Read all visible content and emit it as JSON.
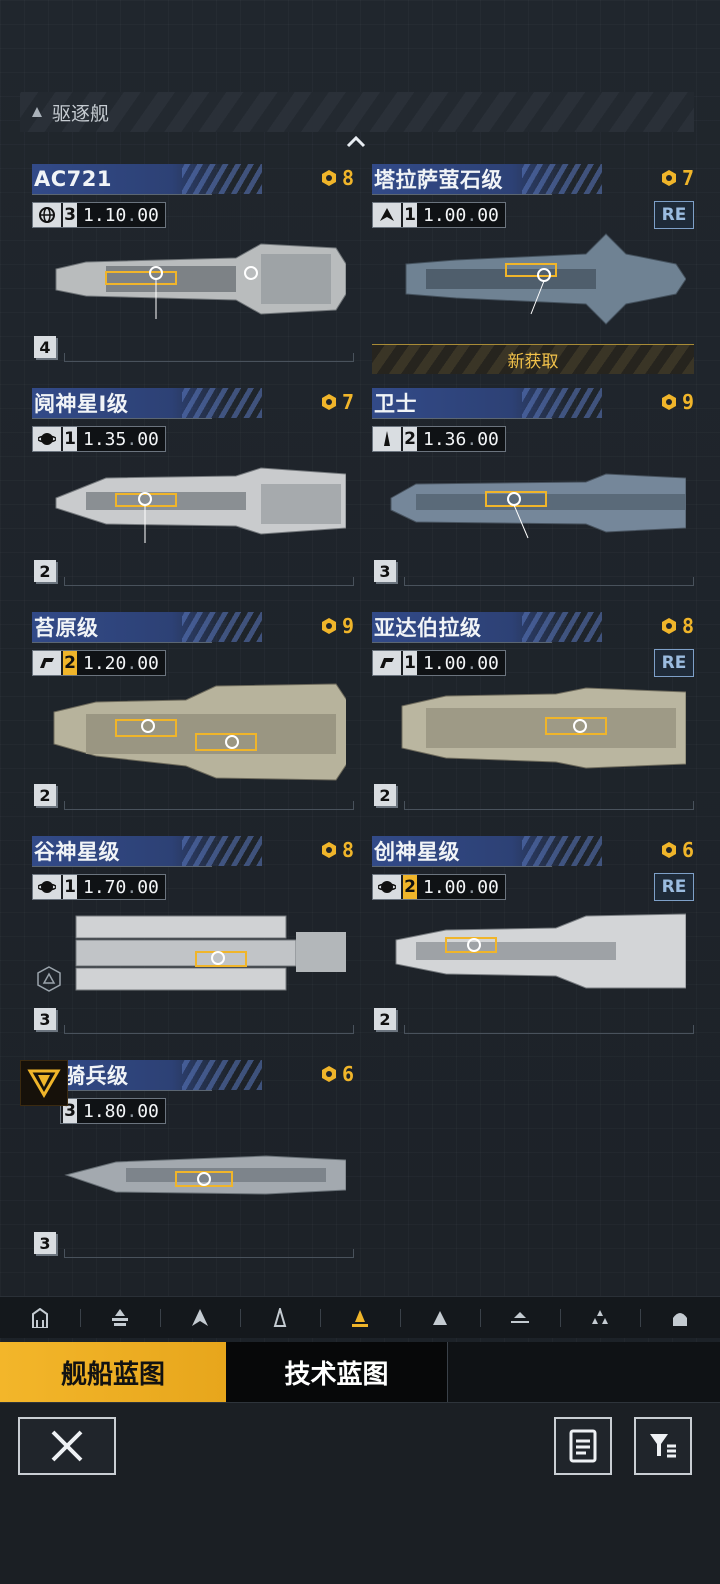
{
  "category": {
    "label": "驱逐舰"
  },
  "ships": [
    {
      "name": "AC721",
      "cost": "8",
      "level": "3",
      "value": "1.10",
      "unit": "00",
      "tier": "4",
      "badge": "",
      "status": ""
    },
    {
      "name": "塔拉萨萤石级",
      "cost": "7",
      "level": "1",
      "value": "1.00",
      "unit": "00",
      "tier": "",
      "badge": "RE",
      "status": "新获取"
    },
    {
      "name": "阋神星I级",
      "cost": "7",
      "level": "1",
      "value": "1.35",
      "unit": "00",
      "tier": "2",
      "badge": "",
      "status": ""
    },
    {
      "name": "卫士",
      "cost": "9",
      "level": "2",
      "value": "1.36",
      "unit": "00",
      "tier": "3",
      "badge": "",
      "status": ""
    },
    {
      "name": "苔原级",
      "cost": "9",
      "level": "2",
      "value": "1.20",
      "unit": "00",
      "tier": "2",
      "badge": "",
      "status": ""
    },
    {
      "name": "亚达伯拉级",
      "cost": "8",
      "level": "1",
      "value": "1.00",
      "unit": "00",
      "tier": "2",
      "badge": "RE",
      "status": ""
    },
    {
      "name": "谷神星级",
      "cost": "8",
      "level": "1",
      "value": "1.70",
      "unit": "00",
      "tier": "3",
      "badge": "",
      "status": ""
    },
    {
      "name": "创神星级",
      "cost": "6",
      "level": "2",
      "value": "1.00",
      "unit": "00",
      "tier": "2",
      "badge": "RE",
      "status": ""
    },
    {
      "name": "骑兵级",
      "cost": "6",
      "level": "3",
      "value": "1.80",
      "unit": "00",
      "tier": "3",
      "badge": "",
      "status": ""
    }
  ],
  "mode_tabs": {
    "ship_blueprint": "舰船蓝图",
    "tech_blueprint": "技术蓝图"
  },
  "colors": {
    "accent": "#f0b52a",
    "header_blue": "#324a88",
    "re_badge": "#9bbce0"
  },
  "icons": {
    "ship_class_tabs": [
      "station-icon",
      "carrier-icon",
      "battlecruiser-icon",
      "cruiser-icon",
      "destroyer-icon",
      "frigate-icon",
      "corvette-icon",
      "fighter-icon",
      "aux-icon"
    ],
    "bottom": [
      "close-icon",
      "document-icon",
      "filter-icon"
    ]
  }
}
